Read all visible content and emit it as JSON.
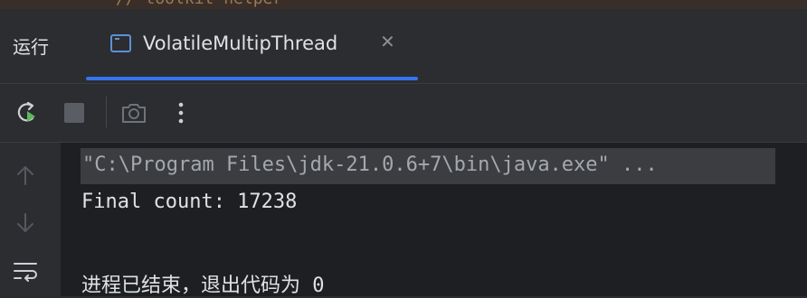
{
  "top_fragment": "// toolkit helper",
  "run_panel": {
    "label": "运行",
    "tab": {
      "title": "VolatileMultipThread",
      "close_glyph": "✕"
    }
  },
  "toolbar": {
    "buttons": [
      "rerun-icon",
      "stop-icon",
      "screenshot-icon",
      "more-options-icon"
    ]
  },
  "gutter": {
    "buttons": [
      "arrow-up-icon",
      "arrow-down-icon",
      "soft-wrap-icon"
    ]
  },
  "console": {
    "command": "\"C:\\Program Files\\jdk-21.0.6+7\\bin\\java.exe\" ...",
    "output_line": "Final count: 17238",
    "exit_line": "进程已结束，退出代码为 0"
  },
  "colors": {
    "accent": "#3574f0",
    "rerun_green": "#5fb85a",
    "background": "#2b2d30",
    "console_bg": "#1e1f22"
  }
}
